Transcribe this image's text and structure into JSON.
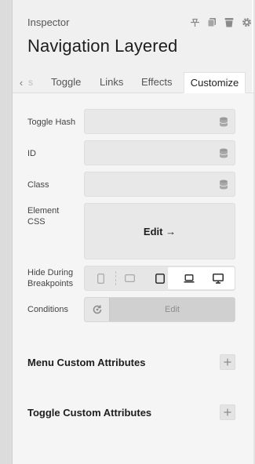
{
  "header": {
    "title": "Inspector",
    "icons": [
      "pin-icon",
      "copy-icon",
      "trash-icon",
      "gear-icon"
    ]
  },
  "page_title": "Navigation Layered",
  "tabs": {
    "faded": "s",
    "items": [
      "Toggle",
      "Links",
      "Effects"
    ],
    "active": "Customize"
  },
  "fields": {
    "toggle_hash_label": "Toggle Hash",
    "id_label": "ID",
    "class_label": "Class",
    "element_css_label": "Element CSS",
    "element_css_button": "Edit →",
    "hide_breakpoints_label": "Hide During Breakpoints",
    "breakpoints": [
      "mobile-portrait-icon",
      "mobile-landscape-icon",
      "tablet-icon",
      "laptop-icon",
      "desktop-icon"
    ],
    "conditions_label": "Conditions",
    "conditions_button": "Edit"
  },
  "sections": {
    "menu_custom_attributes": "Menu Custom Attributes",
    "toggle_custom_attributes": "Toggle Custom Attributes"
  },
  "colors": {
    "panel_bg": "#f5f5f5",
    "field_bg": "#e8e8e8",
    "active_tab_bg": "#ffffff",
    "disabled_button_bg": "#d0d0d0"
  }
}
